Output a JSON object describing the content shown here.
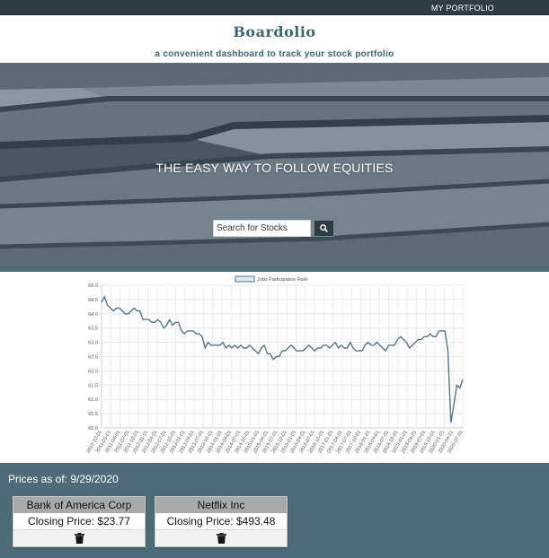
{
  "topbar": {
    "nav_portfolio": "MY PORTFOLIO"
  },
  "brand": {
    "logo_text": "Boardolio",
    "tagline": "a convenient dashboard to track your stock portfolio"
  },
  "hero": {
    "headline": "THE EASY WAY TO FOLLOW EQUITIES",
    "search": {
      "placeholder": "Search for Stocks",
      "icon": "search-icon"
    }
  },
  "chart_data": {
    "type": "line",
    "title": "",
    "xlabel": "",
    "ylabel": "",
    "legend": "top-center",
    "grid": true,
    "series_color": "#56748a",
    "series": [
      {
        "name": "Jobs Participation Rate",
        "values": [
          64.4,
          64.6,
          64.3,
          64.2,
          64.1,
          64.2,
          64.2,
          64.1,
          64.0,
          64.0,
          64.1,
          64.2,
          64.1,
          64.1,
          63.8,
          63.8,
          63.8,
          63.7,
          63.7,
          63.8,
          63.7,
          63.5,
          63.6,
          63.8,
          63.6,
          63.7,
          63.7,
          63.4,
          63.3,
          63.4,
          63.4,
          63.4,
          63.3,
          63.3,
          63.2,
          62.8,
          63.0,
          62.9,
          62.9,
          62.9,
          62.9,
          63.0,
          62.8,
          62.9,
          62.8,
          62.9,
          62.8,
          62.9,
          62.8,
          62.8,
          62.9,
          62.8,
          62.7,
          62.6,
          62.8,
          62.9,
          62.6,
          62.6,
          62.4,
          62.5,
          62.5,
          62.7,
          62.7,
          62.8,
          62.9,
          62.8,
          62.7,
          62.7,
          62.7,
          62.8,
          62.9,
          62.8,
          62.7,
          62.8,
          62.8,
          62.9,
          62.9,
          62.8,
          62.9,
          63.0,
          62.8,
          62.9,
          62.8,
          62.8,
          63.0,
          62.8,
          62.7,
          62.7,
          62.7,
          62.9,
          63.0,
          62.9,
          62.9,
          63.0,
          62.9,
          62.8,
          62.7,
          62.9,
          62.9,
          62.9,
          63.1,
          63.2,
          63.1,
          63.0,
          62.8,
          62.9,
          63.0,
          63.1,
          63.1,
          63.2,
          63.2,
          63.3,
          63.2,
          63.2,
          63.4,
          63.4,
          63.4,
          62.7,
          60.2,
          60.8,
          61.5,
          61.4,
          61.7
        ]
      }
    ],
    "x": [
      "2010-10-01",
      "2011-01-01",
      "2011-04-01",
      "2011-07-01",
      "2011-10-01",
      "2012-01-01",
      "2012-04-01",
      "2012-07-01",
      "2012-10-01",
      "2013-01-01",
      "2013-04-01",
      "2013-07-01",
      "2013-10-01",
      "2014-01-01",
      "2014-04-01",
      "2014-07-01",
      "2014-10-01",
      "2015-01-01",
      "2015-04-01",
      "2015-07-01",
      "2015-10-01",
      "2016-01-01",
      "2016-04-01",
      "2016-07-01",
      "2016-10-01",
      "2017-01-01",
      "2017-04-01",
      "2017-07-01",
      "2017-10-01",
      "2018-01-01",
      "2018-04-01",
      "2018-07-01",
      "2018-10-01",
      "2019-01-01",
      "2019-04-01",
      "2019-07-01",
      "2019-10-01",
      "2020-01-01",
      "2020-04-01",
      "2020-07-01"
    ],
    "y_ticks": [
      "65.0",
      "64.5",
      "64.0",
      "63.5",
      "63.0",
      "62.5",
      "62.0",
      "61.5",
      "61.0",
      "60.5",
      "60.0"
    ],
    "ylim": [
      60.0,
      65.0
    ]
  },
  "prices": {
    "as_of_label": "Prices as of: 9/29/2020",
    "stocks": [
      {
        "name": "Bank of America Corp",
        "closing": "Closing Price: $23.77",
        "delete_icon": "trash-icon"
      },
      {
        "name": "Netflix Inc",
        "closing": "Closing Price: $493.48",
        "delete_icon": "trash-icon"
      }
    ]
  }
}
